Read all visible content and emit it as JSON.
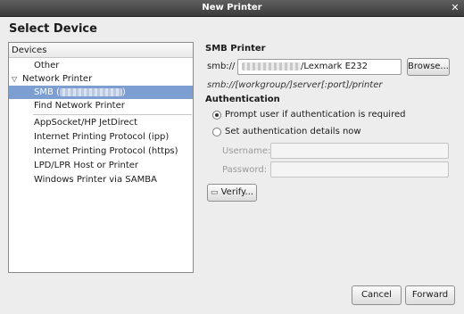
{
  "window": {
    "title": "New Printer",
    "close_glyph": "✕"
  },
  "heading": "Select Device",
  "devices": {
    "header": "Devices",
    "items": [
      {
        "label": "Other"
      },
      {
        "label": "Network Printer"
      },
      {
        "label": "SMB (",
        "suffix": ")"
      },
      {
        "label": "Find Network Printer"
      },
      {
        "label": "AppSocket/HP JetDirect"
      },
      {
        "label": "Internet Printing Protocol (ipp)"
      },
      {
        "label": "Internet Printing Protocol (https)"
      },
      {
        "label": "LPD/LPR Host or Printer"
      },
      {
        "label": "Windows Printer via SAMBA"
      }
    ]
  },
  "smb": {
    "title": "SMB Printer",
    "url_label": "smb://",
    "url_value": "/Lexmark E232",
    "browse_label": "Browse...",
    "format_hint": "smb://[workgroup/]server[:port]/printer"
  },
  "auth": {
    "title": "Authentication",
    "prompt_option": "Prompt user if authentication is required",
    "set_option": "Set authentication details now",
    "username_label": "Username:",
    "password_label": "Password:",
    "verify_label": "Verify..."
  },
  "footer": {
    "cancel_label": "Cancel",
    "forward_label": "Forward"
  }
}
